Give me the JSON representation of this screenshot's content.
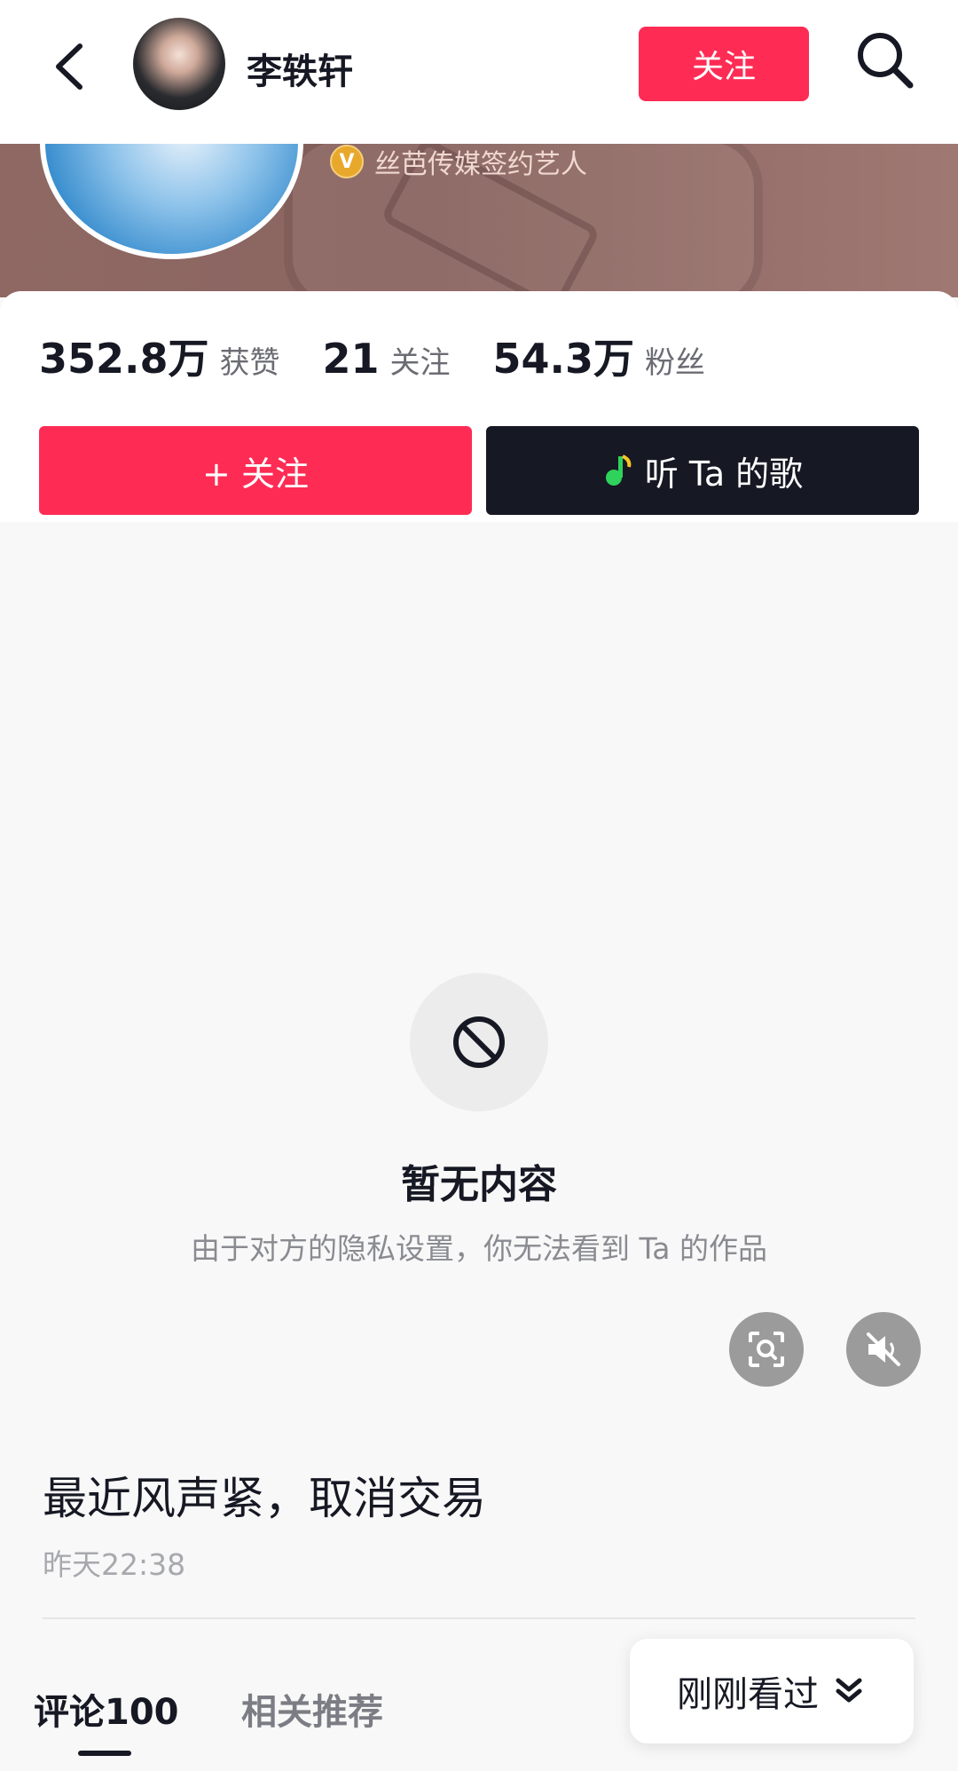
{
  "header": {
    "username": "李轶轩",
    "follow_label": "关注"
  },
  "banner": {
    "verified_label": "丝芭传媒签约艺人",
    "verified_badge": "V"
  },
  "stats": [
    {
      "value": "352.8万",
      "label": "获赞"
    },
    {
      "value": "21",
      "label": "关注"
    },
    {
      "value": "54.3万",
      "label": "粉丝"
    }
  ],
  "actions": {
    "follow_label": "+ 关注",
    "song_label": "听 Ta 的歌"
  },
  "empty_state": {
    "title": "暂无内容",
    "subtitle": "由于对方的隐私设置，你无法看到 Ta 的作品"
  },
  "post": {
    "text": "最近风声紧，取消交易",
    "time": "昨天22:38"
  },
  "tabs": [
    {
      "label": "评论100",
      "active": true
    },
    {
      "label": "相关推荐",
      "active": false
    }
  ],
  "recent": {
    "label": "刚刚看过"
  },
  "colors": {
    "accent": "#fe2c55",
    "dark": "#161823"
  }
}
